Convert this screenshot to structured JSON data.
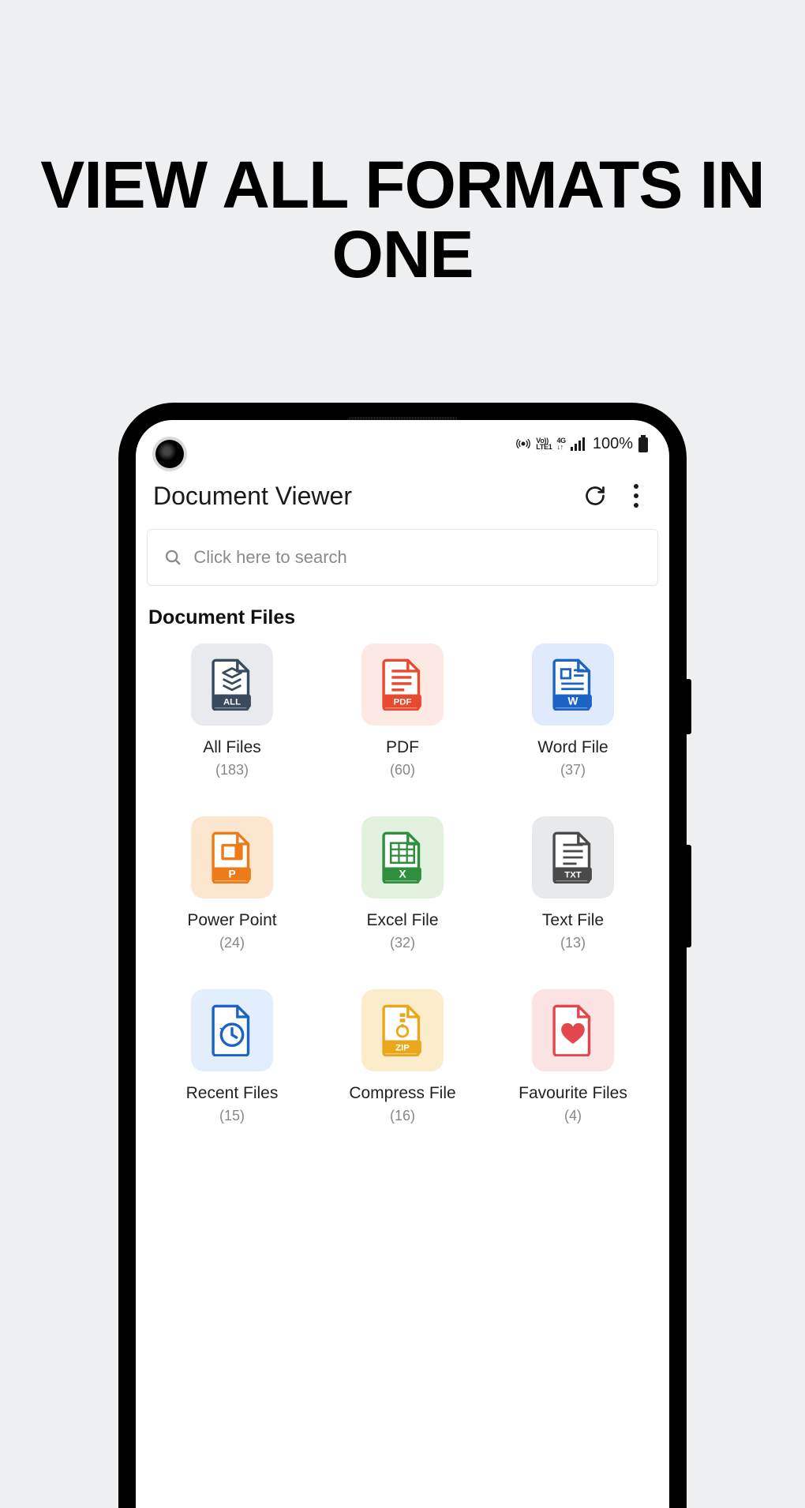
{
  "promo": {
    "headline": "VIEW ALL FORMATS IN ONE"
  },
  "status": {
    "network": "LTE1",
    "volte": "Vo))",
    "net_speed": "4G",
    "battery_pct": "100%"
  },
  "app": {
    "title": "Document Viewer"
  },
  "search": {
    "placeholder": "Click here to search",
    "value": ""
  },
  "section": {
    "title": "Document Files"
  },
  "tiles": [
    {
      "id": "all",
      "label": "All Files",
      "count": "(183)",
      "bg": "#e8eaee",
      "accent": "#3a4a5e",
      "tag": "ALL"
    },
    {
      "id": "pdf",
      "label": "PDF",
      "count": "(60)",
      "bg": "#fde9e3",
      "accent": "#e74a2f",
      "tag": "PDF"
    },
    {
      "id": "word",
      "label": "Word File",
      "count": "(37)",
      "bg": "#dfeafc",
      "accent": "#1d63c6",
      "tag": "W"
    },
    {
      "id": "ppt",
      "label": "Power Point",
      "count": "(24)",
      "bg": "#fde6cf",
      "accent": "#ee7b1a",
      "tag": "P"
    },
    {
      "id": "excel",
      "label": "Excel File",
      "count": "(32)",
      "bg": "#e1f1de",
      "accent": "#2f8f3f",
      "tag": "X"
    },
    {
      "id": "txt",
      "label": "Text File",
      "count": "(13)",
      "bg": "#e7e9eb",
      "accent": "#4a4a4a",
      "tag": "TXT"
    },
    {
      "id": "recent",
      "label": "Recent Files",
      "count": "(15)",
      "bg": "#e3eefc",
      "accent": "#1d63c6",
      "tag": "HIST"
    },
    {
      "id": "zip",
      "label": "Compress File",
      "count": "(16)",
      "bg": "#fbeccb",
      "accent": "#e9a81c",
      "tag": "ZIP"
    },
    {
      "id": "fav",
      "label": "Favourite Files",
      "count": "(4)",
      "bg": "#fbe3e3",
      "accent": "#e2474d",
      "tag": "FAV"
    }
  ]
}
